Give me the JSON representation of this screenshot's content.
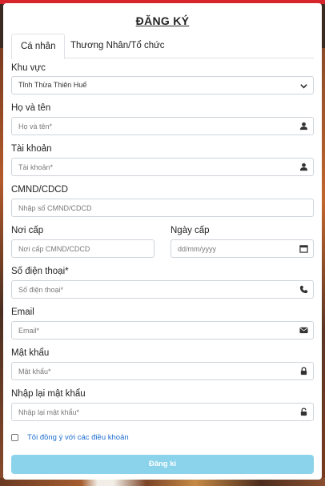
{
  "form": {
    "title": "ĐĂNG KÝ",
    "tabs": [
      {
        "label": "Cá nhân"
      },
      {
        "label": "Thương Nhân/Tổ chức"
      }
    ],
    "region": {
      "label": "Khu vực",
      "value": "Tỉnh Thừa Thiên Huế"
    },
    "fullname": {
      "label": "Họ và tên",
      "placeholder": "Họ và tên*"
    },
    "account": {
      "label": "Tài khoản",
      "placeholder": "Tài khoản*"
    },
    "idcard": {
      "label": "CMND/CDCD",
      "placeholder": "Nhập số CMND/CDCD"
    },
    "issue_place": {
      "label": "Nơi cấp",
      "placeholder": "Nơi cấp CMND/CDCD"
    },
    "issue_date": {
      "label": "Ngày cấp",
      "placeholder": "dd/mm/yyyy"
    },
    "phone": {
      "label": "Số điện thoại*",
      "placeholder": "Số điện thoại*"
    },
    "email": {
      "label": "Email",
      "placeholder": "Email*"
    },
    "password": {
      "label": "Mật khẩu",
      "placeholder": "Mật khẩu*"
    },
    "confirm_password": {
      "label": "Nhập lại mật khẩu",
      "placeholder": "Nhập lại mật khẩu*"
    },
    "agree_label": "Tôi đồng ý với các điều khoản",
    "submit_label": "Đăng kí"
  },
  "colors": {
    "accent_red": "#d6262b",
    "button": "#8ad3ea",
    "link": "#1f6fd0"
  },
  "icons": {
    "fullname": "user-icon",
    "account": "user-icon",
    "issue_date": "calendar-icon",
    "phone": "phone-icon",
    "email": "envelope-icon",
    "password": "lock-icon",
    "confirm_password": "unlock-icon",
    "region": "chevron-down-icon"
  }
}
